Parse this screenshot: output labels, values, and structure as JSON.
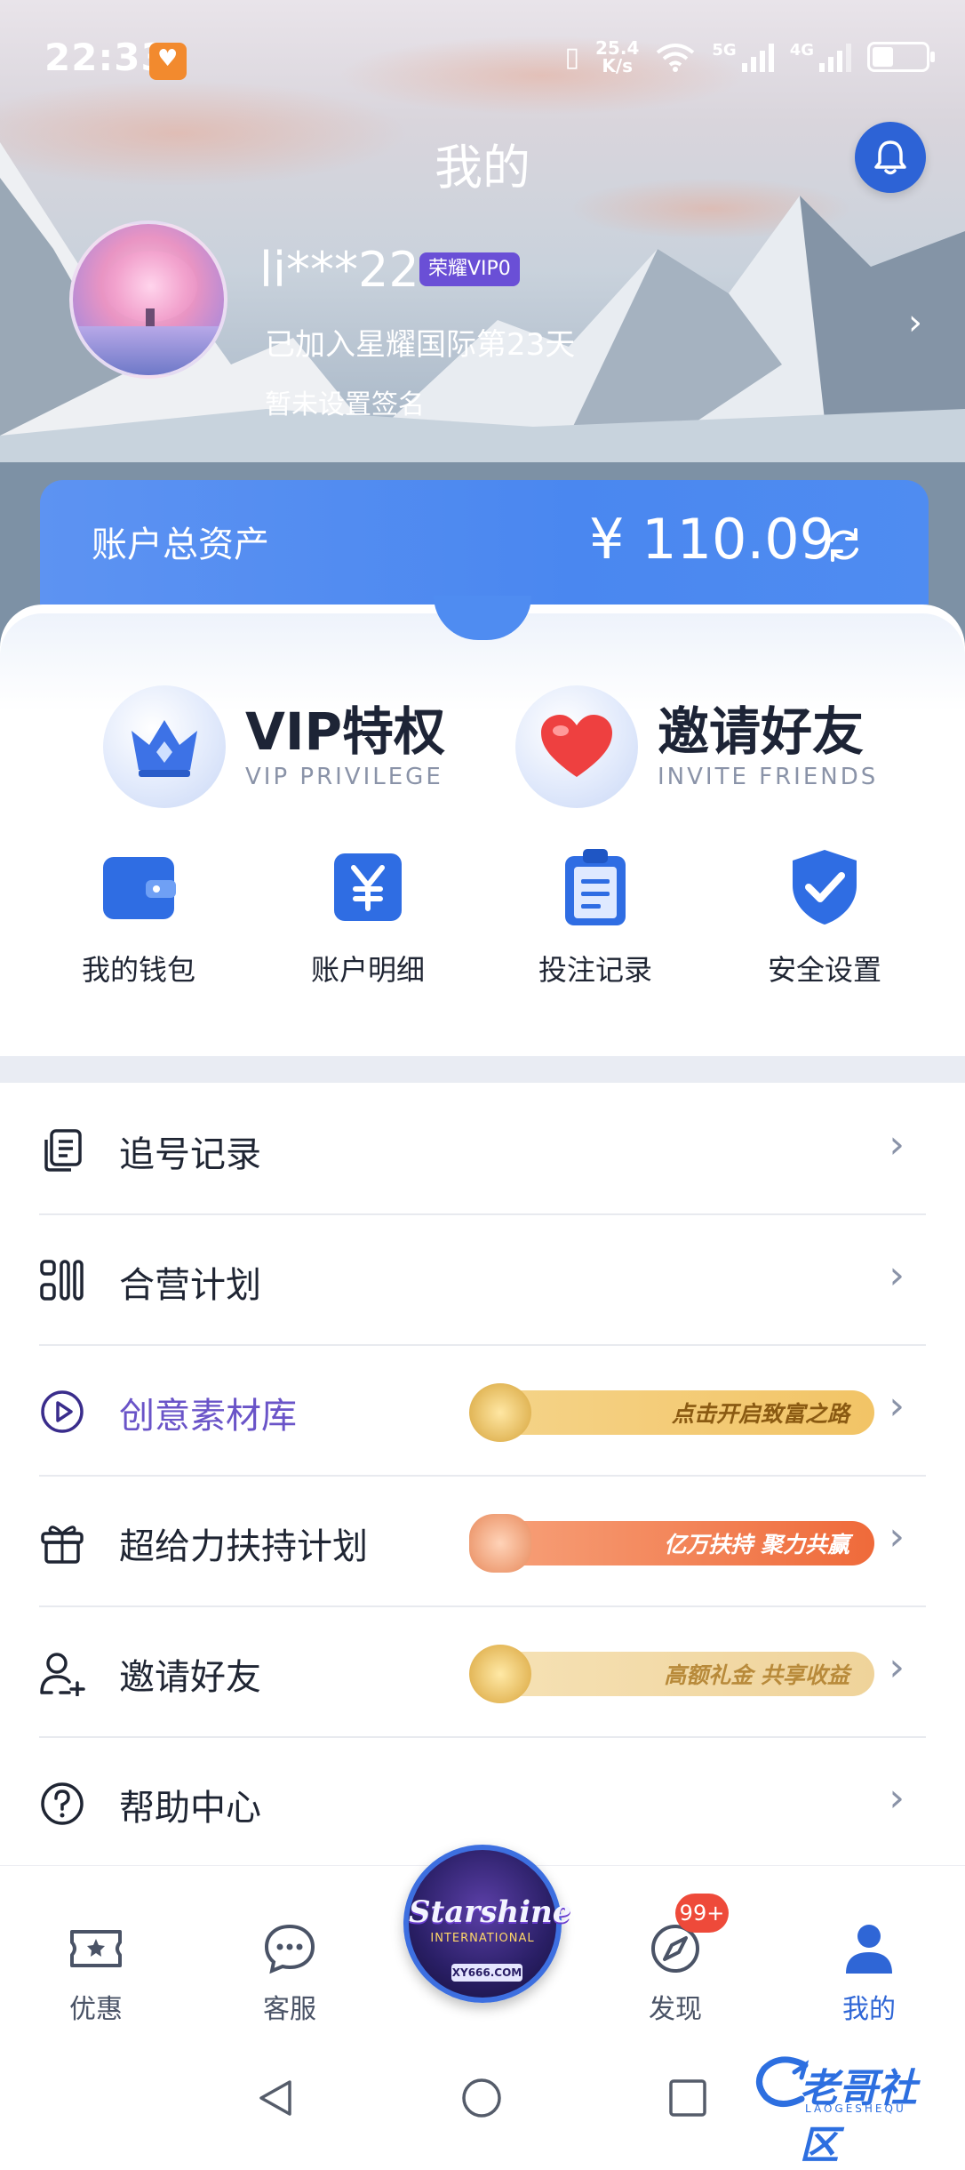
{
  "status_bar": {
    "time": "22:33",
    "net_speed_value": "25.4",
    "net_speed_unit": "K/s",
    "network_5g": "5G",
    "network_4g": "4G",
    "battery_level": 0.4
  },
  "header": {
    "title": "我的",
    "bell_icon": "bell-icon"
  },
  "profile": {
    "username": "li***22",
    "vip_badge": "荣耀VIP0",
    "join_text": "已加入星耀国际第23天",
    "signature": "暂未设置签名",
    "arrow": "›"
  },
  "assets": {
    "label": "账户总资产",
    "value": "¥ 110.09",
    "refresh_icon": "refresh-icon"
  },
  "promos": [
    {
      "title": "VIP特权",
      "subtitle": "VIP PRIVILEGE",
      "icon": "crown-icon"
    },
    {
      "title": "邀请好友",
      "subtitle": "INVITE FRIENDS",
      "icon": "heart-icon"
    }
  ],
  "quick_actions": [
    {
      "label": "我的钱包",
      "icon": "wallet-icon"
    },
    {
      "label": "账户明细",
      "icon": "yen-icon"
    },
    {
      "label": "投注记录",
      "icon": "clipboard-icon"
    },
    {
      "label": "安全设置",
      "icon": "shield-check-icon"
    }
  ],
  "menu": [
    {
      "label": "追号记录",
      "icon": "copy-doc-icon",
      "banner": ""
    },
    {
      "label": "合营计划",
      "icon": "grid-apps-icon",
      "banner": ""
    },
    {
      "label": "创意素材库",
      "icon": "play-circle-icon",
      "banner": "点击开启致富之路"
    },
    {
      "label": "超给力扶持计划",
      "icon": "gift-icon",
      "banner": "亿万扶持 聚力共赢"
    },
    {
      "label": "邀请好友",
      "icon": "add-user-icon",
      "banner": "高额礼金 共享收益"
    },
    {
      "label": "帮助中心",
      "icon": "help-circle-icon",
      "banner": ""
    }
  ],
  "menu_arrow": "›",
  "bottom_nav": {
    "items": [
      {
        "label": "优惠",
        "icon": "ticket-star-icon"
      },
      {
        "label": "客服",
        "icon": "chat-bubble-icon"
      },
      {
        "label": "发现",
        "icon": "compass-icon"
      },
      {
        "label": "我的",
        "icon": "user-icon"
      }
    ],
    "discover_badge": "99+",
    "center_logo": {
      "title": "Starshine",
      "subtitle": "INTERNATIONAL",
      "url": "XY666.COM"
    }
  },
  "watermark": {
    "text": "老哥社区",
    "sub": "LAOGESHEQU"
  },
  "colors": {
    "primary": "#2f66d6",
    "asset_card": "#4a87f0",
    "purple_text": "#6a54c8",
    "badge_red": "#ee4a3a"
  }
}
